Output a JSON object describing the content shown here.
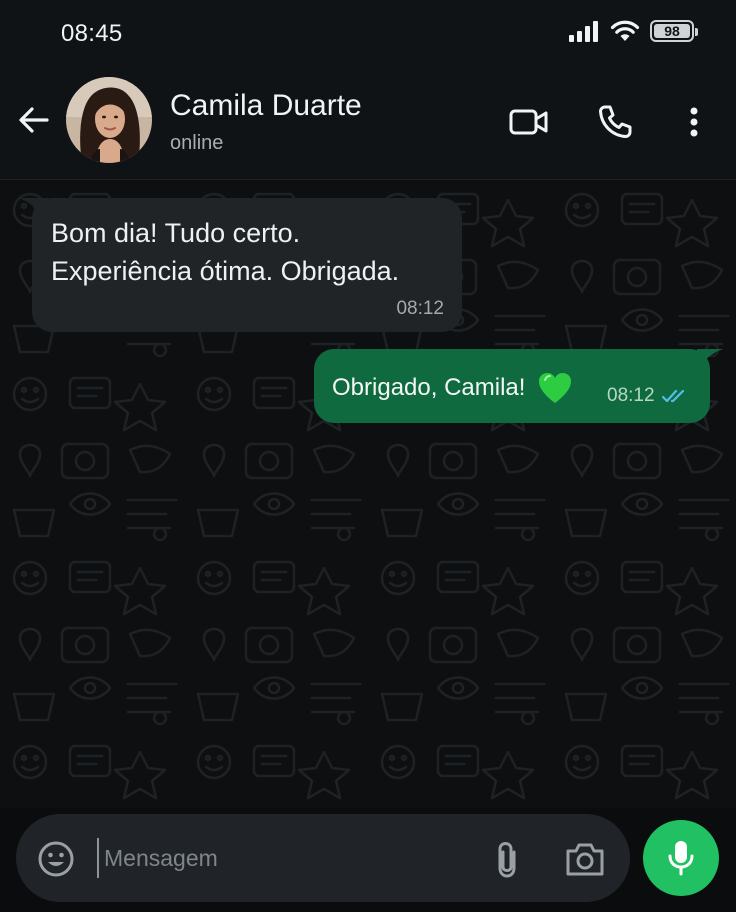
{
  "status_bar": {
    "time": "08:45",
    "battery": "98",
    "icons": [
      "signal-icon",
      "wifi-icon",
      "battery-icon"
    ]
  },
  "header": {
    "back_icon": "back-arrow-icon",
    "name": "Camila Duarte",
    "status": "online",
    "actions": [
      "video-call-icon",
      "phone-icon",
      "more-options-icon"
    ]
  },
  "messages": [
    {
      "direction": "incoming",
      "lines": [
        "Bom dia! Tudo certo.",
        "Experiência ótima. Obrigada."
      ],
      "time": "08:12"
    },
    {
      "direction": "outgoing",
      "text": "Obrigado, Camila!",
      "emoji": "green-heart-icon",
      "time": "08:12",
      "read_receipt": "double-check-icon"
    }
  ],
  "composer": {
    "placeholder": "Mensagem",
    "value": "",
    "icons": [
      "emoji-icon",
      "paperclip-icon",
      "camera-icon",
      "microphone-icon"
    ]
  },
  "colors": {
    "header_bg": "#101316",
    "chat_bg": "#0d0f10",
    "incoming_bubble": "#202427",
    "outgoing_bubble": "#0f6b3f",
    "accent_green": "#21c063",
    "read_receipt_blue": "#53bdeb"
  }
}
